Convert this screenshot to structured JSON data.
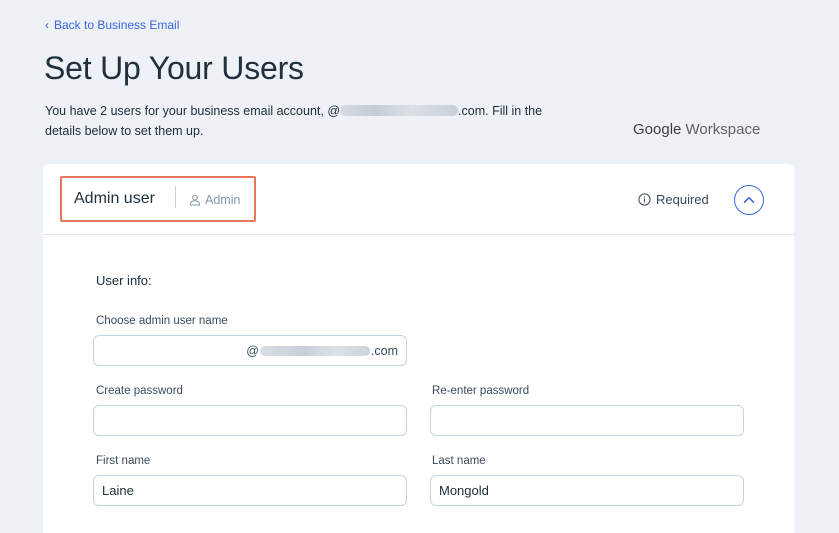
{
  "nav": {
    "back_label": "Back to Business Email"
  },
  "page": {
    "title": "Set Up Your Users",
    "subtitle_part1": "You have 2 users for your business email account, @",
    "subtitle_part2": ".com. Fill in the details below to set them up."
  },
  "brand": {
    "google": "Google",
    "workspace": "Workspace"
  },
  "card": {
    "title": "Admin user",
    "role_tag": "Admin",
    "required_label": "Required",
    "section_title": "User info:"
  },
  "form": {
    "username": {
      "label": "Choose admin user name",
      "value": "",
      "suffix_at": "@",
      "suffix_com": ".com"
    },
    "password": {
      "label": "Create password",
      "value": ""
    },
    "reenter_password": {
      "label": "Re-enter password",
      "value": ""
    },
    "first_name": {
      "label": "First name",
      "value": "Laine"
    },
    "last_name": {
      "label": "Last name",
      "value": "Mongold"
    }
  },
  "colors": {
    "accent": "#3b66e0",
    "highlight": "#e8775d",
    "background": "#eef1f5"
  },
  "icons": {
    "back": "chevron-left-icon",
    "person": "person-icon",
    "info": "info-icon",
    "collapse": "chevron-up-icon"
  }
}
